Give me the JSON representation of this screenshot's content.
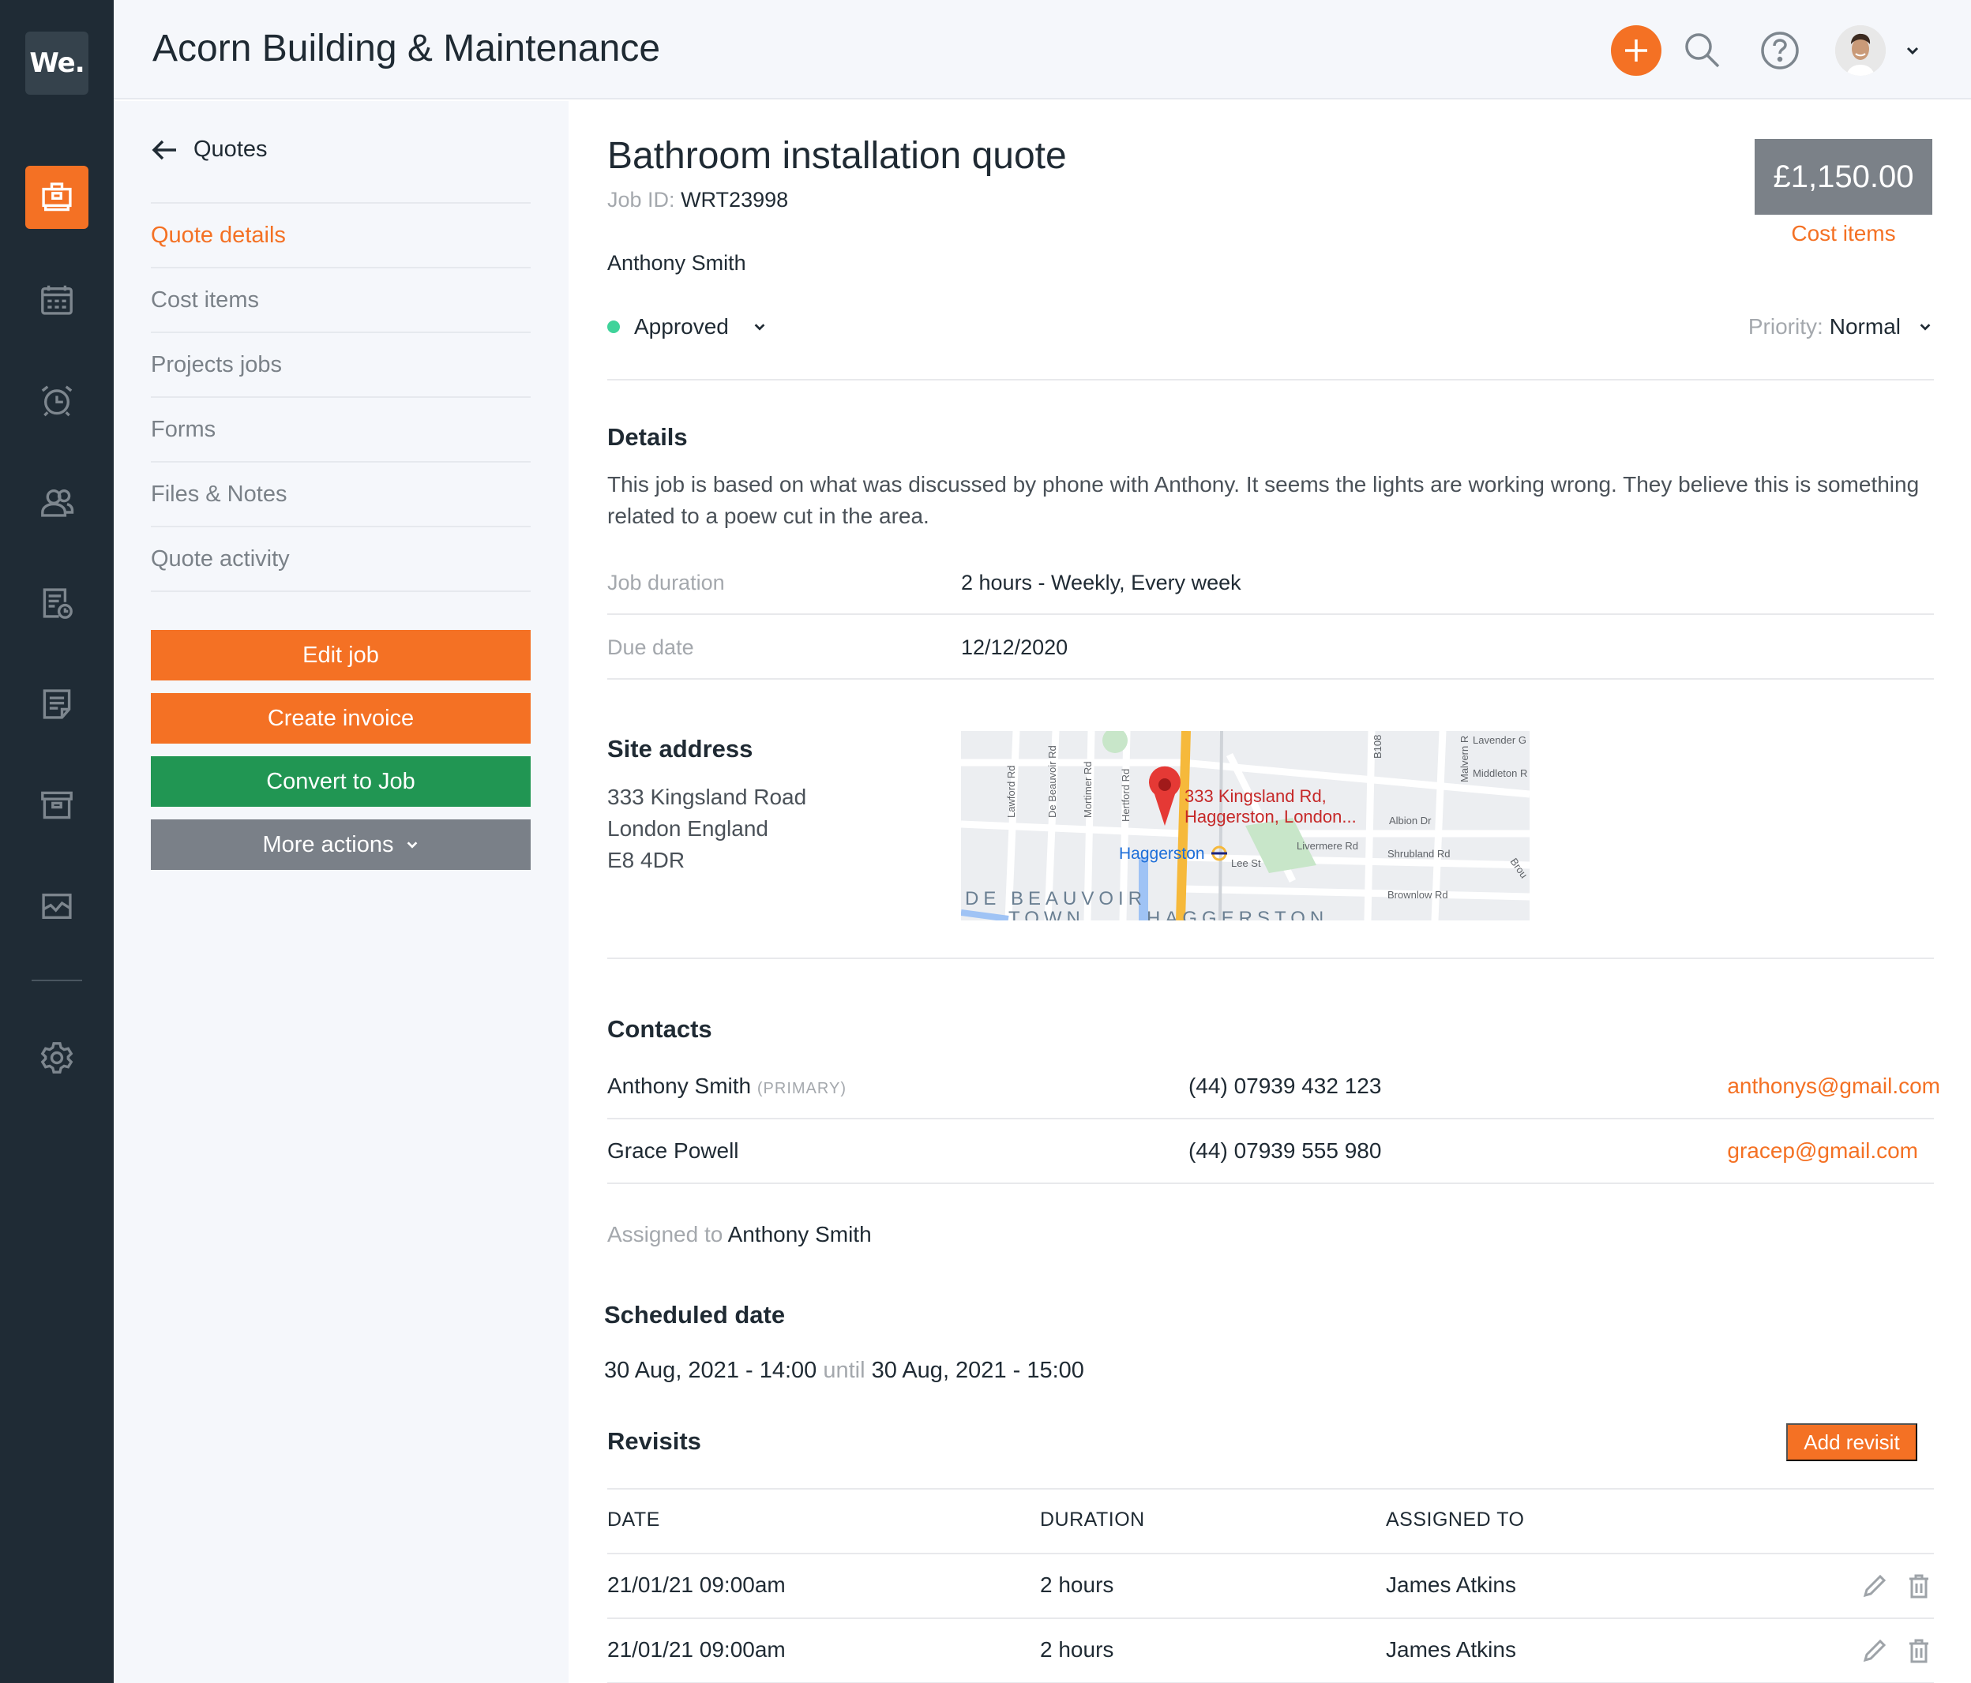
{
  "sidebar": {
    "logo": "We.",
    "items": [
      {
        "name": "jobs",
        "icon": "briefcase-icon",
        "active": true
      },
      {
        "name": "calendar",
        "icon": "calendar-icon",
        "active": false
      },
      {
        "name": "reminders",
        "icon": "alarm-clock-icon",
        "active": false
      },
      {
        "name": "customers",
        "icon": "users-icon",
        "active": false
      },
      {
        "name": "timesheets",
        "icon": "document-clock-icon",
        "active": false
      },
      {
        "name": "notes",
        "icon": "note-icon",
        "active": false
      },
      {
        "name": "archive",
        "icon": "archive-box-icon",
        "active": false
      },
      {
        "name": "reports",
        "icon": "activity-chart-icon",
        "active": false
      },
      {
        "name": "settings",
        "icon": "gear-icon",
        "active": false
      }
    ]
  },
  "header": {
    "title": "Acorn Building & Maintenance",
    "add_icon": "plus-icon",
    "search_icon": "search-icon",
    "help_icon": "help-circle-icon",
    "avatar": "user-avatar"
  },
  "left_panel": {
    "back_label": "Quotes",
    "nav": [
      {
        "label": "Quote details",
        "active": true
      },
      {
        "label": "Cost items",
        "active": false
      },
      {
        "label": "Projects jobs",
        "active": false
      },
      {
        "label": "Forms",
        "active": false
      },
      {
        "label": "Files & Notes",
        "active": false
      },
      {
        "label": "Quote activity",
        "active": false
      }
    ],
    "buttons": {
      "edit_job": "Edit job",
      "create_invoice": "Create invoice",
      "convert_to_job": "Convert to Job",
      "more_actions": "More actions"
    }
  },
  "quote": {
    "title": "Bathroom installation quote",
    "job_id_label": "Job ID:",
    "job_id": "WRT23998",
    "price": "£1,150.00",
    "cost_items_link": "Cost items",
    "customer": "Anthony Smith",
    "status": "Approved",
    "status_color": "#3fd39a",
    "priority_label": "Priority:",
    "priority": "Normal"
  },
  "details": {
    "title": "Details",
    "description": "This job is based on what was discussed by phone with Anthony. It seems the lights are working wrong. They believe this is something related to a poew cut in the area.",
    "fields": [
      {
        "label": "Job duration",
        "value": "2 hours - Weekly, Every week"
      },
      {
        "label": "Due date",
        "value": "12/12/2020"
      }
    ]
  },
  "site": {
    "title": "Site address",
    "lines": [
      "333 Kingsland Road",
      "London England",
      "E8 4DR"
    ],
    "map": {
      "pin_label_1": "333 Kingsland Rd,",
      "pin_label_2": "Haggerston, London...",
      "station": "Haggerston",
      "district_1": "DE BEAUVOIR",
      "district_1b": "TOWN",
      "district_2": "HAGGERSTON",
      "streets": [
        "Lawford Rd",
        "De Beauvoir Rd",
        "Mortimer Rd",
        "Hertford Rd",
        "Albion Dr",
        "Livermere Rd",
        "Lee St",
        "Shrubland Rd",
        "Brownlow Rd",
        "Lavender G",
        "Middleton R",
        "Malvern R",
        "B108",
        "Brou"
      ]
    }
  },
  "contacts": {
    "title": "Contacts",
    "primary_tag": "(PRIMARY)",
    "rows": [
      {
        "name": "Anthony Smith",
        "primary": true,
        "phone": "(44) 07939 432 123",
        "email": "anthonys@gmail.com"
      },
      {
        "name": "Grace Powell",
        "primary": false,
        "phone": "(44) 07939 555 980",
        "email": "gracep@gmail.com"
      }
    ],
    "assigned_label": "Assigned to",
    "assigned_to": "Anthony Smith"
  },
  "schedule": {
    "title": "Scheduled date",
    "start": "30 Aug, 2021 - 14:00",
    "until": "until",
    "end": "30 Aug, 2021 - 15:00"
  },
  "revisits": {
    "title": "Revisits",
    "add_label": "Add revisit",
    "columns": [
      "DATE",
      "DURATION",
      "ASSIGNED TO"
    ],
    "rows": [
      {
        "date": "21/01/21 09:00am",
        "duration": "2 hours",
        "assigned": "James Atkins"
      },
      {
        "date": "21/01/21 09:00am",
        "duration": "2 hours",
        "assigned": "James Atkins"
      }
    ]
  }
}
